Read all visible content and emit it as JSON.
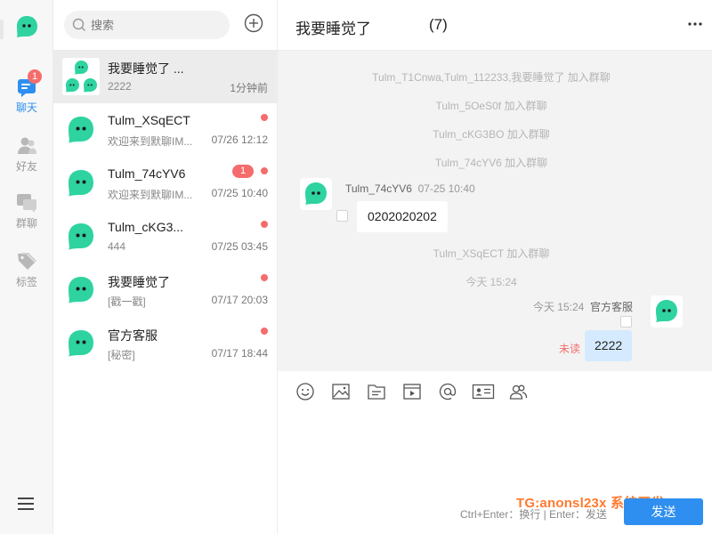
{
  "rail": {
    "items": [
      {
        "label": "聊天",
        "icon": "chat-icon",
        "badge": "1",
        "active": true
      },
      {
        "label": "好友",
        "icon": "friends-icon"
      },
      {
        "label": "群聊",
        "icon": "group-chat-icon"
      },
      {
        "label": "标签",
        "icon": "tag-icon"
      }
    ],
    "menu_icon": "hamburger-menu-icon"
  },
  "search": {
    "placeholder": "搜索"
  },
  "conversations": [
    {
      "name": "我要睡觉了 ...",
      "preview": "2222",
      "time": "1分钟前",
      "avatar": "group-avatar",
      "active": true
    },
    {
      "name": "Tulm_XSqECT",
      "preview": "欢迎来到默聊IM...",
      "time": "07/26 12:12",
      "dot": true
    },
    {
      "name": "Tulm_74cYV6",
      "preview": "欢迎来到默聊IM...",
      "time": "07/25 10:40",
      "badge": "1",
      "dot": true
    },
    {
      "name": "Tulm_cKG3...",
      "preview": "444",
      "time": "07/25 03:45",
      "dot": true
    },
    {
      "name": "我要睡觉了",
      "preview": "[戳一戳]",
      "time": "07/17 20:03",
      "dot": true
    },
    {
      "name": "官方客服",
      "preview": "[秘密]",
      "time": "07/17 18:44",
      "dot": true
    }
  ],
  "chat": {
    "title": "我要睡觉了",
    "member_count": "(7)",
    "system_messages": [
      "Tulm_T1Cnwa,Tulm_112233,我要睡觉了 加入群聊",
      "Tulm_5OeS0f 加入群聊",
      "Tulm_cKG3BO 加入群聊",
      "Tulm_74cYV6 加入群聊",
      "Tulm_XSqECT 加入群聊",
      "今天 15:24"
    ],
    "incoming": {
      "sender": "Tulm_74cYV6",
      "time": "07-25 10:40",
      "text": "0202020202"
    },
    "outgoing": {
      "sender": "官方客服",
      "time": "今天 15:24",
      "text": "2222",
      "status": "未读"
    }
  },
  "composer": {
    "tools": [
      "emoji-icon",
      "image-icon",
      "file-icon",
      "video-icon",
      "mention-icon",
      "contact-card-icon",
      "group-members-icon"
    ],
    "hint": "Ctrl+Enter：换行 | Enter：发送",
    "send_label": "发送",
    "watermark": "TG:anonsl23x 系统开发"
  },
  "colors": {
    "accent": "#2f8ff0",
    "brand_green": "#2ed3a0",
    "badge_red": "#f56c6c",
    "out_bubble": "#d6eaff"
  }
}
